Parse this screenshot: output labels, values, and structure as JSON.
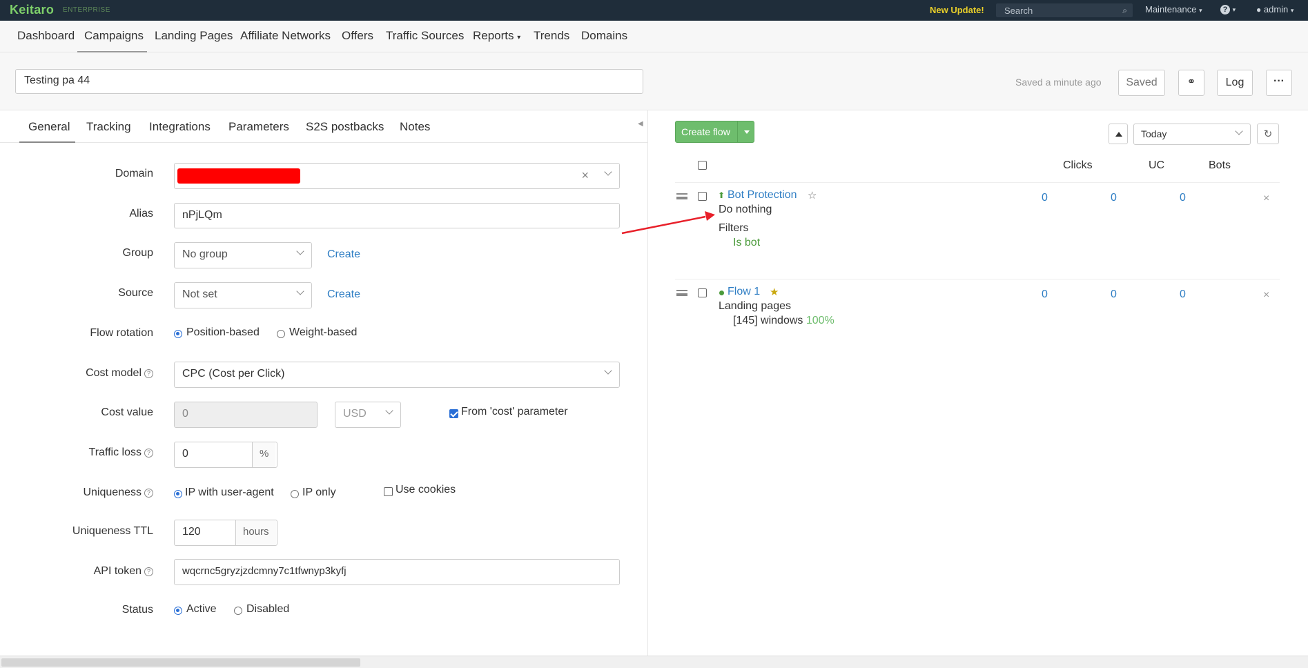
{
  "topbar": {
    "logo": "Keitaro",
    "edition": "ENTERPRISE",
    "new_update": "New Update!",
    "search_placeholder": "Search",
    "maintenance": "Maintenance",
    "help": "?",
    "user": "admin"
  },
  "nav": {
    "items": [
      "Dashboard",
      "Campaigns",
      "Landing Pages",
      "Affiliate Networks",
      "Offers",
      "Traffic Sources",
      "Reports",
      "Trends",
      "Domains"
    ],
    "active": "Campaigns"
  },
  "campaign": {
    "name": "Testing pa 44",
    "saved_ago": "Saved a minute ago",
    "saved_label": "Saved",
    "log_label": "Log",
    "more_label": "···"
  },
  "tabs": [
    "General",
    "Tracking",
    "Integrations",
    "Parameters",
    "S2S postbacks",
    "Notes"
  ],
  "form": {
    "domain_label": "Domain",
    "alias_label": "Alias",
    "alias_value": "nPjLQm",
    "group_label": "Group",
    "group_value": "No group",
    "create_label": "Create",
    "source_label": "Source",
    "source_value": "Not set",
    "flow_rotation_label": "Flow rotation",
    "position_based": "Position-based",
    "weight_based": "Weight-based",
    "cost_model_label": "Cost model",
    "cost_model_value": "CPC (Cost per Click)",
    "cost_value_label": "Cost value",
    "cost_value": "0",
    "currency": "USD",
    "from_cost_param": "From 'cost' parameter",
    "traffic_loss_label": "Traffic loss",
    "traffic_loss_value": "0",
    "percent": "%",
    "uniqueness_label": "Uniqueness",
    "ip_with_ua": "IP with user-agent",
    "ip_only": "IP only",
    "use_cookies": "Use cookies",
    "uniqueness_ttl_label": "Uniqueness TTL",
    "uniqueness_ttl_value": "120",
    "hours": "hours",
    "api_token_label": "API token",
    "api_token_value": "wqcrnc5gryzjzdcmny7c1tfwnyp3kyfj",
    "status_label": "Status",
    "active": "Active",
    "disabled": "Disabled"
  },
  "flows_panel": {
    "create_flow": "Create flow",
    "period": "Today",
    "col_clicks": "Clicks",
    "col_uc": "UC",
    "col_bots": "Bots"
  },
  "flows": [
    {
      "title": "Bot Protection",
      "action": "Do nothing",
      "section": "Filters",
      "detail": "Is bot",
      "clicks": "0",
      "uc": "0",
      "bots": "0"
    },
    {
      "title": "Flow 1",
      "action": "Landing pages",
      "detail": "[145] windows",
      "share": "100%",
      "clicks": "0",
      "uc": "0",
      "bots": "0"
    }
  ],
  "colors": {
    "topbar": "#1f2d3a",
    "accent_green": "#6ebd6d",
    "link_blue": "#2f7ec4",
    "redact_red": "#ff0000",
    "arrow_red": "#e8202a",
    "update_yellow": "#e9cf2a"
  }
}
